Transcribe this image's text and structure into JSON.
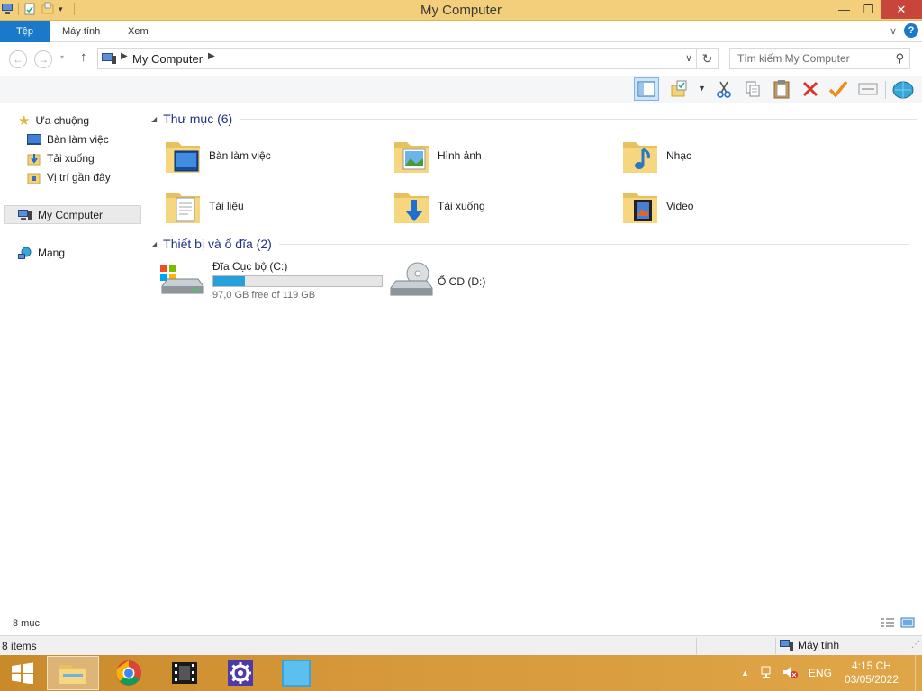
{
  "window": {
    "title": "My Computer"
  },
  "ribbon": {
    "tabs": [
      "Tệp",
      "Máy tính",
      "Xem"
    ]
  },
  "address": {
    "location": "My Computer"
  },
  "search": {
    "placeholder": "Tìm kiếm My Computer"
  },
  "toolbar": {
    "buttons": [
      "layout-icon",
      "folder-options-icon",
      "cut-icon",
      "copy-icon",
      "paste-icon",
      "delete-icon",
      "check-icon",
      "properties-icon",
      "network-icon"
    ]
  },
  "nav": {
    "favorites_label": "Ưa chuộng",
    "favorites": [
      "Bàn làm việc",
      "Tải xuống",
      "Vị trí gần đây"
    ],
    "computer_label": "My Computer",
    "network_label": "Mạng"
  },
  "folders": {
    "header": "Thư mục (6)",
    "items": [
      {
        "name": "Bàn làm việc",
        "icon": "desktop-folder-icon"
      },
      {
        "name": "Hình ảnh",
        "icon": "pictures-folder-icon"
      },
      {
        "name": "Nhạc",
        "icon": "music-folder-icon"
      },
      {
        "name": "Tài liệu",
        "icon": "documents-folder-icon"
      },
      {
        "name": "Tải xuống",
        "icon": "downloads-folder-icon"
      },
      {
        "name": "Video",
        "icon": "videos-folder-icon"
      }
    ]
  },
  "devices": {
    "header": "Thiết bị và ổ đĩa (2)",
    "drive_c": {
      "name": "Đĩa Cục bộ (C:)",
      "free_text": "97,0 GB free of 119 GB",
      "used_fraction": 0.185
    },
    "drive_d": {
      "name": "Ổ CD (D:)"
    }
  },
  "status": {
    "count_top": "8 mục",
    "count_bottom": "8 items",
    "location": "Máy tính"
  },
  "taskbar": {
    "language": "ENG",
    "time": "4:15 CH",
    "date": "03/05/2022"
  },
  "colors": {
    "titlebar": "#f3cf7c",
    "accent": "#1979ca",
    "drive_fill": "#26a0da",
    "header_text": "#1e3287"
  }
}
